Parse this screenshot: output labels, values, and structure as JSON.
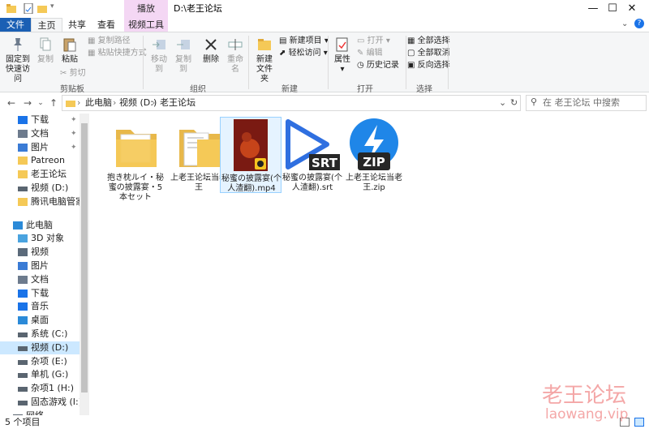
{
  "window": {
    "title": "D:\\老王论坛",
    "context_tab": "播放",
    "controls": {
      "minimize": "—",
      "maximize": "☐",
      "close": "✕"
    }
  },
  "ribbon_tabs": [
    "文件",
    "主页",
    "共享",
    "查看",
    "视频工具"
  ],
  "ribbon": {
    "clipboard": {
      "pin": "固定到快速访问",
      "copy": "复制",
      "paste": "粘贴",
      "copy_path": "复制路径",
      "paste_shortcut": "粘贴快捷方式",
      "cut": "剪切",
      "group": "剪贴板"
    },
    "organize": {
      "move_to": "移动到",
      "copy_to": "复制到",
      "delete": "删除",
      "rename": "重命名",
      "group": "组织"
    },
    "new": {
      "new_folder": "新建文件夹",
      "new_item": "新建项目",
      "easy_access": "轻松访问",
      "group": "新建"
    },
    "open": {
      "properties": "属性",
      "open": "打开",
      "edit": "编辑",
      "history": "历史记录",
      "group": "打开"
    },
    "select": {
      "select_all": "全部选择",
      "select_none": "全部取消",
      "invert": "反向选择",
      "group": "选择"
    }
  },
  "address": {
    "crumbs": [
      "此电脑",
      "视频 (D:)",
      "老王论坛"
    ],
    "search_placeholder": "在 老王论坛 中搜索"
  },
  "nav": {
    "quick_access": [
      {
        "label": "下载",
        "icon": "download-icon",
        "pinned": true
      },
      {
        "label": "文档",
        "icon": "document-icon",
        "pinned": true
      },
      {
        "label": "图片",
        "icon": "picture-icon",
        "pinned": true
      },
      {
        "label": "Patreon",
        "icon": "folder-icon",
        "pinned": false
      },
      {
        "label": "老王论坛",
        "icon": "folder-icon",
        "pinned": false
      },
      {
        "label": "视频 (D:)",
        "icon": "drive-icon",
        "pinned": false
      },
      {
        "label": "腾讯电脑管家截图",
        "icon": "folder-icon",
        "pinned": false
      }
    ],
    "this_pc": "此电脑",
    "pc_items": [
      {
        "label": "3D 对象",
        "icon": "3d-icon"
      },
      {
        "label": "视频",
        "icon": "video-icon"
      },
      {
        "label": "图片",
        "icon": "picture-icon"
      },
      {
        "label": "文档",
        "icon": "document-icon"
      },
      {
        "label": "下载",
        "icon": "download-icon"
      },
      {
        "label": "音乐",
        "icon": "music-icon"
      },
      {
        "label": "桌面",
        "icon": "desktop-icon"
      },
      {
        "label": "系统 (C:)",
        "icon": "drive-icon"
      },
      {
        "label": "视频 (D:)",
        "icon": "drive-icon",
        "selected": true
      },
      {
        "label": "杂项 (E:)",
        "icon": "drive-icon"
      },
      {
        "label": "单机 (G:)",
        "icon": "drive-icon"
      },
      {
        "label": "杂项1 (H:)",
        "icon": "drive-icon"
      },
      {
        "label": "固态游戏 (I:)",
        "icon": "drive-icon"
      }
    ],
    "network": "网络"
  },
  "files": [
    {
      "name": "抱き枕ルイ・秘蜜の披露宴・5本セット",
      "icon": "folder-icon"
    },
    {
      "name": "上老王论坛当老王",
      "icon": "folder-icon"
    },
    {
      "name": "秘蜜の披露宴(个人渣翻).mp4",
      "icon": "video-thumbnail-icon",
      "selected": true
    },
    {
      "name": "秘蜜の披露宴(个人渣翻).srt",
      "icon": "srt-icon",
      "badge": "SRT"
    },
    {
      "name": "上老王论坛当老王.zip",
      "icon": "zip-icon",
      "badge": "ZIP"
    }
  ],
  "status": {
    "count": "5 个项目"
  },
  "watermark": {
    "cn": "老王论坛",
    "url": "laowang.vip"
  },
  "colors": {
    "accent": "#1a5fb4",
    "context_tab": "#f4d7f4",
    "folder": "#f5c957",
    "selection": "#cce8ff"
  }
}
